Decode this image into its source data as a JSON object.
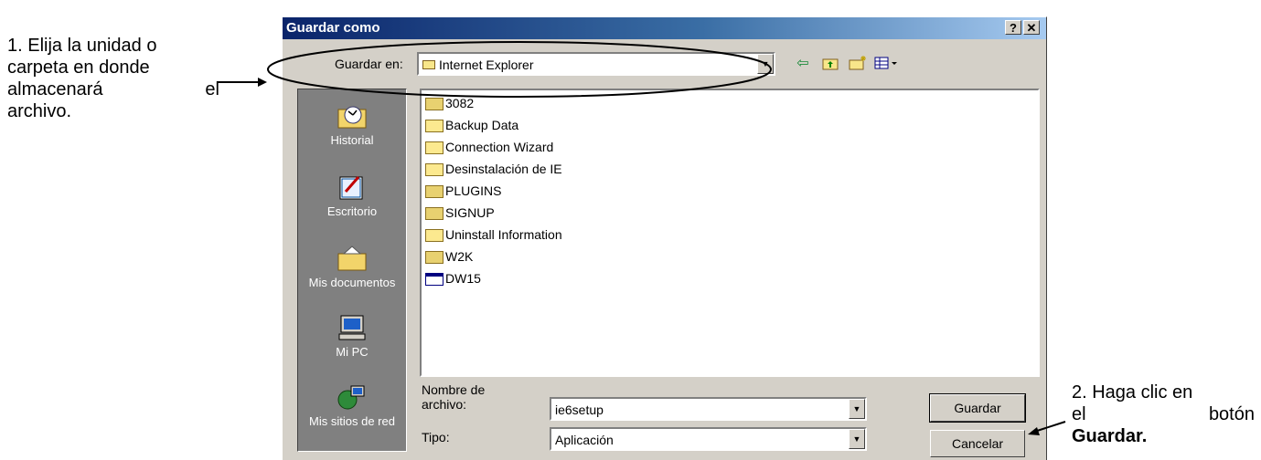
{
  "annotations": {
    "note1_lines": [
      "1. Elija la unidad o",
      "carpeta en donde",
      "almacenará el",
      "archivo."
    ],
    "note2_lines": [
      "2. Haga clic en",
      "el botón"
    ],
    "note2_bold": "Guardar."
  },
  "dialog": {
    "title": "Guardar como",
    "help_label": "?",
    "close_label": "✕",
    "save_in_label": "Guardar en:",
    "save_in_value": "Internet Explorer",
    "places": [
      "Historial",
      "Escritorio",
      "Mis documentos",
      "Mi PC",
      "Mis sitios de red"
    ],
    "files": [
      {
        "name": "3082",
        "type": "folder"
      },
      {
        "name": "Backup Data",
        "type": "folder-light"
      },
      {
        "name": "Connection Wizard",
        "type": "folder-light"
      },
      {
        "name": "Desinstalación de IE",
        "type": "folder-light"
      },
      {
        "name": "PLUGINS",
        "type": "folder"
      },
      {
        "name": "SIGNUP",
        "type": "folder"
      },
      {
        "name": "Uninstall Information",
        "type": "folder-light"
      },
      {
        "name": "W2K",
        "type": "folder"
      },
      {
        "name": "DW15",
        "type": "app"
      }
    ],
    "filename_label_lines": [
      "Nombre de",
      "archivo:"
    ],
    "filename_value": "ie6setup",
    "type_label": "Tipo:",
    "type_value": "Aplicación",
    "save_button": "Guardar",
    "cancel_button": "Cancelar"
  }
}
